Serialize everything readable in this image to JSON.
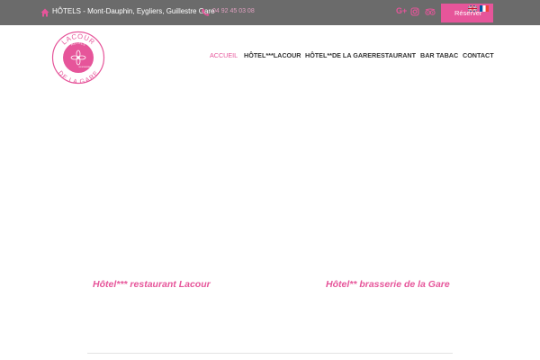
{
  "topbar": {
    "address": "HÔTELS - Mont-Dauphin, Eygliers, Guillestre Gare",
    "phone": "04 92 45 03 08",
    "gplus_label": "G+",
    "reserve_label": "Réserver"
  },
  "logo": {
    "top_text": "LACOUR",
    "mid_text": "HÔTELS",
    "bottom_text": "DE LA GARE",
    "tiny_text": "RESTAURANT"
  },
  "nav": {
    "items": [
      "ACCUEIL",
      "HÔTEL***LACOUR",
      "HÔTEL**DE LA GARE",
      "RESTAURANT",
      "BAR TABAC",
      "CONTACT"
    ]
  },
  "content": {
    "hotel_lacour": "Hôtel*** restaurant Lacour",
    "hotel_gare": "Hôtel** brasserie de la Gare"
  },
  "colors": {
    "accent": "#e6559a",
    "topbar_bg": "#6b6b6b"
  }
}
